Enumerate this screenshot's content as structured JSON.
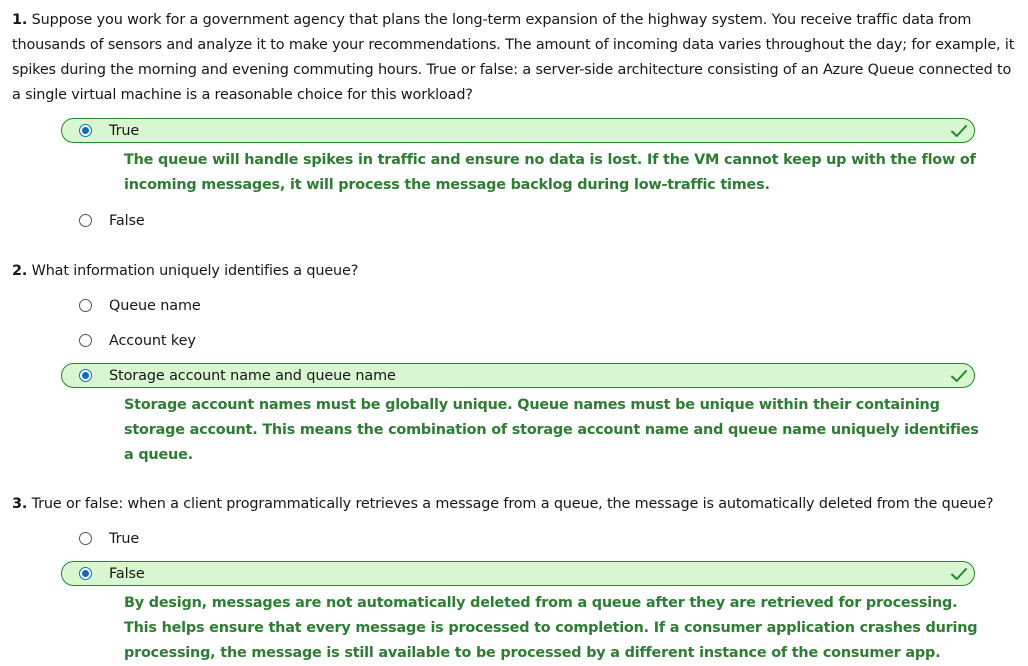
{
  "questions": [
    {
      "number": "1.",
      "text": "Suppose you work for a government agency that plans the long-term expansion of the highway system. You receive traffic data from thousands of sensors and analyze it to make your recommendations. The amount of incoming data varies throughout the day; for example, it spikes during the morning and evening commuting hours. True or false: a server-side architecture consisting of an Azure Queue connected to a single virtual machine is a reasonable choice for this workload?",
      "options": [
        {
          "label": "True",
          "selected": true,
          "correct": true
        },
        {
          "label": "False",
          "selected": false,
          "correct": false
        }
      ],
      "explanation": "The queue will handle spikes in traffic and ensure no data is lost. If the VM cannot keep up with the flow of incoming messages, it will process the message backlog during low-traffic times."
    },
    {
      "number": "2.",
      "text": "What information uniquely identifies a queue?",
      "options": [
        {
          "label": "Queue name",
          "selected": false,
          "correct": false
        },
        {
          "label": "Account key",
          "selected": false,
          "correct": false
        },
        {
          "label": "Storage account name and queue name",
          "selected": true,
          "correct": true
        }
      ],
      "explanation": "Storage account names must be globally unique. Queue names must be unique within their containing storage account. This means the combination of storage account name and queue name uniquely identifies a queue."
    },
    {
      "number": "3.",
      "text": "True or false: when a client programmatically retrieves a message from a queue, the message is automatically deleted from the queue?",
      "options": [
        {
          "label": "True",
          "selected": false,
          "correct": false
        },
        {
          "label": "False",
          "selected": true,
          "correct": true
        }
      ],
      "explanation": "By design, messages are not automatically deleted from a queue after they are retrieved for processing. This helps ensure that every message is processed to completion. If a consumer application crashes during processing, the message is still available to be processed by a different instance of the consumer app."
    }
  ],
  "icons": {
    "correct": "checkmark-icon",
    "selected": "radio-selected-icon",
    "unselected": "radio-empty-icon"
  },
  "colors": {
    "correct_bg": "#d8f6cf",
    "correct_border": "#1f8a2b",
    "explanation_text": "#2d7d32",
    "radio_selected": "#0f6cbd",
    "checkmark": "#1f8a2b"
  }
}
